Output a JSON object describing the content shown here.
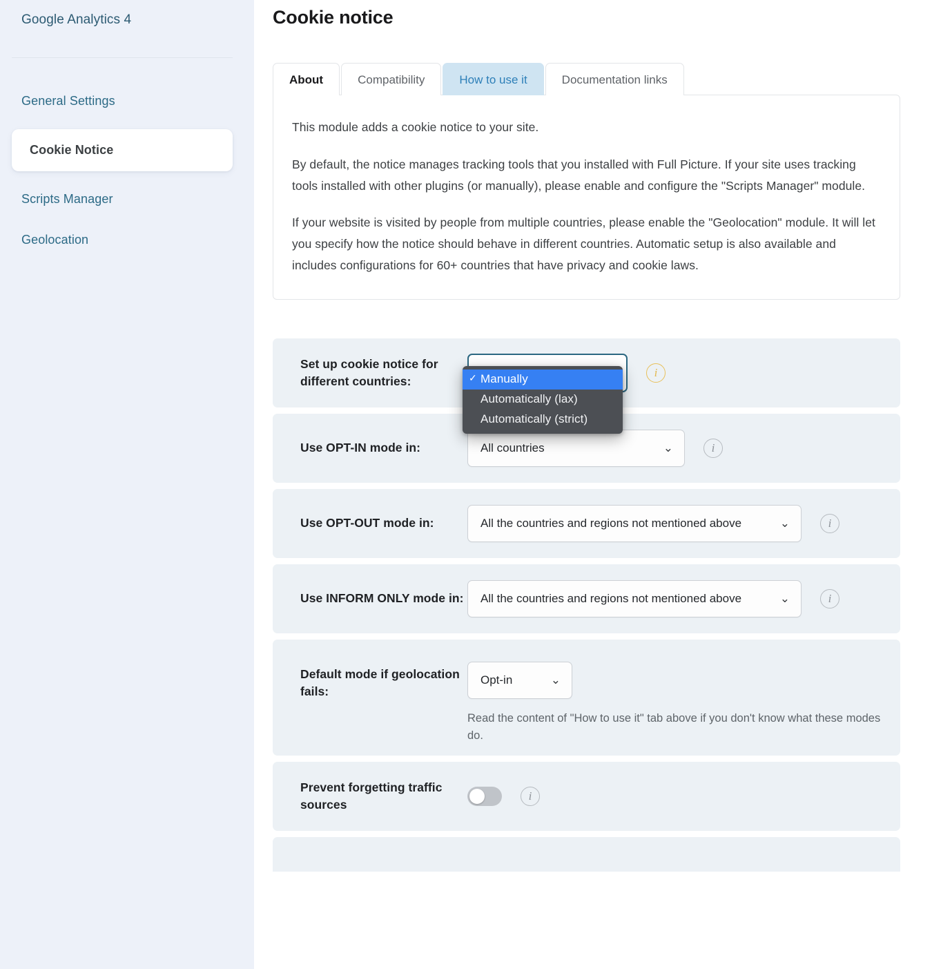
{
  "sidebar": {
    "title": "Google Analytics 4",
    "items": [
      {
        "label": "General Settings",
        "active": false
      },
      {
        "label": "Cookie Notice",
        "active": true
      },
      {
        "label": "Scripts Manager",
        "active": false
      },
      {
        "label": "Geolocation",
        "active": false
      }
    ]
  },
  "main": {
    "page_title": "Cookie notice",
    "tabs": [
      {
        "label": "About",
        "state": "active"
      },
      {
        "label": "Compatibility",
        "state": "normal"
      },
      {
        "label": "How to use it",
        "state": "highlight"
      },
      {
        "label": "Documentation links",
        "state": "normal"
      }
    ],
    "about": {
      "p1": "This module adds a cookie notice to your site.",
      "p2": "By default, the notice manages tracking tools that you installed with Full Picture. If your site uses tracking tools installed with other plugins (or manually), please enable and configure the \"Scripts Manager\" module.",
      "p3": "If your website is visited by people from multiple countries, please enable the \"Geolocation\" module. It will let you specify how the notice should behave in different countries. Automatic setup is also available and includes configurations for 60+ countries that have privacy and cookie laws."
    },
    "settings": {
      "setup_countries": {
        "label": "Set up cookie notice for different countries:",
        "value": "Manually",
        "options": [
          "Manually",
          "Automatically (lax)",
          "Automatically (strict)"
        ],
        "selected_index": 0,
        "info_icon": "info-icon",
        "info_color": "#e3b94f"
      },
      "opt_in": {
        "label": "Use OPT-IN mode in:",
        "value": "All countries",
        "chevron": "⌄",
        "info_icon": "info-icon"
      },
      "opt_out": {
        "label": "Use OPT-OUT mode in:",
        "value": "All the countries and regions not mentioned above",
        "chevron": "⌄",
        "info_icon": "info-icon"
      },
      "inform_only": {
        "label": "Use INFORM ONLY mode in:",
        "value": "All the countries and regions not mentioned above",
        "chevron": "⌄",
        "info_icon": "info-icon"
      },
      "default_mode": {
        "label": "Default mode if geolocation fails:",
        "value": "Opt-in",
        "chevron": "⌄",
        "helper": "Read the content of \"How to use it\" tab above if you don't know what these modes do."
      },
      "prevent_forgetting": {
        "label": "Prevent forgetting traffic sources",
        "toggle_state": "off",
        "info_icon": "info-icon"
      }
    }
  },
  "icons": {
    "info_glyph": "i",
    "check_glyph": "✓",
    "chevron_glyph": "⌄"
  }
}
